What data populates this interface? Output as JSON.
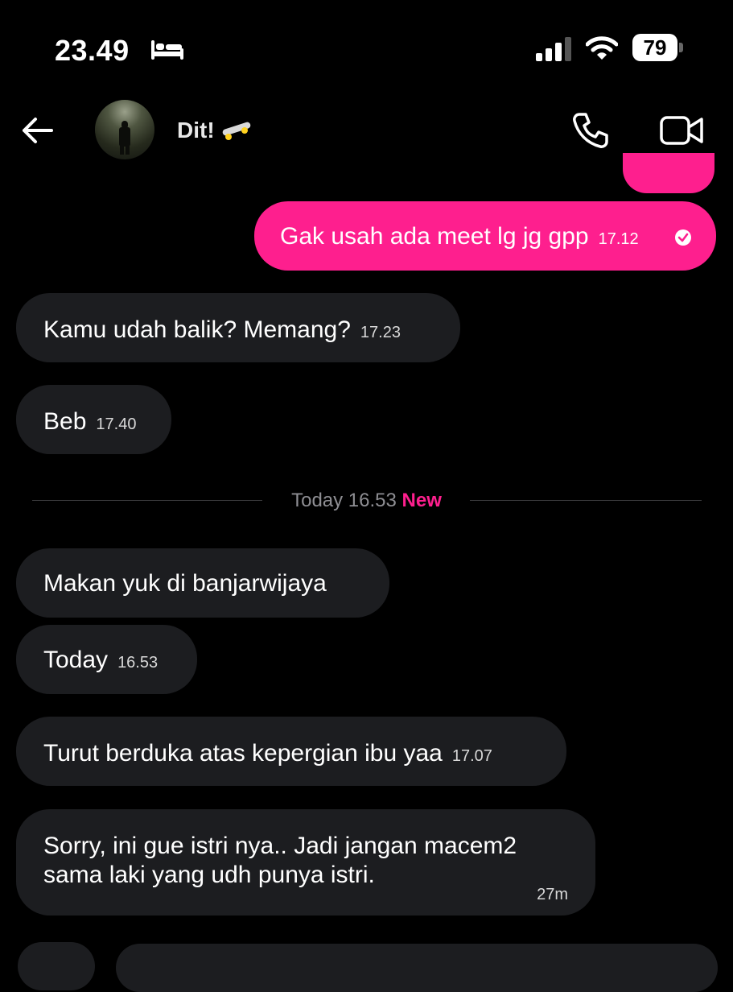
{
  "status_bar": {
    "time": "23.49",
    "sleep_icon": "bed-icon",
    "signal_icon": "cellular-signal-icon",
    "wifi_icon": "wifi-icon",
    "battery": "79"
  },
  "header": {
    "back_icon": "arrow-left-icon",
    "contact_name": "Dit!",
    "name_emoji": "skateboard-icon",
    "call_icon": "phone-icon",
    "video_icon": "video-camera-icon"
  },
  "messages": [
    {
      "direction": "out",
      "text": "Gak usah ada meet lg jg gpp",
      "time": "17.12",
      "status_icon": "read-check-icon"
    },
    {
      "direction": "in",
      "text": "Kamu udah balik? Memang?",
      "time": "17.23"
    },
    {
      "direction": "in",
      "text": "Beb",
      "time": "17.40"
    },
    {
      "direction": "in",
      "text": "Makan yuk di banjarwijaya",
      "time": ""
    },
    {
      "direction": "in",
      "text": "Today",
      "time": "16.53"
    },
    {
      "direction": "in",
      "text": "Turut berduka atas kepergian ibu yaa",
      "time": "17.07"
    },
    {
      "direction": "in",
      "text_line1": "Sorry, ini gue istri nya.. Jadi jangan macem2",
      "text_line2": "sama laki yang udh punya istri.",
      "time": "27m"
    }
  ],
  "divider": {
    "label": "Today 16.53",
    "new_label": "New"
  },
  "colors": {
    "accent": "#fe1f8e",
    "incoming_bubble": "#1c1d20",
    "background": "#000000"
  }
}
